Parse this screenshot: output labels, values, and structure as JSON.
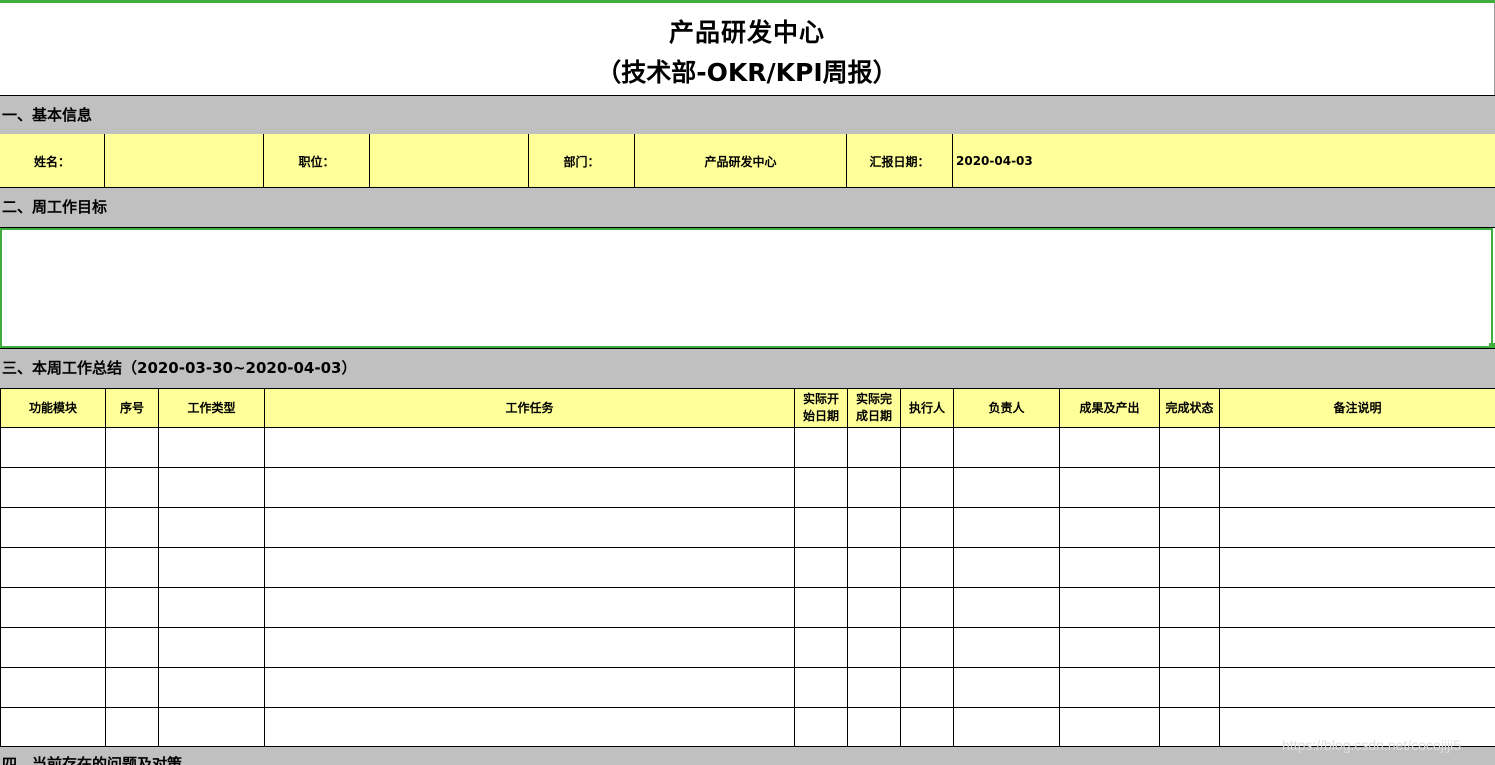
{
  "title": {
    "line1": "产品研发中心",
    "line2": "（技术部-OKR/KPI周报）"
  },
  "sections": {
    "basic_info": "一、基本信息",
    "weekly_goal": "二、周工作目标",
    "weekly_summary": "三、本周工作总结（2020-03-30~2020-04-03）",
    "issues": "四、当前存在的问题及对策"
  },
  "basic_info": {
    "name_label": "姓名：",
    "name_value": "",
    "position_label": "职位：",
    "position_value": "",
    "department_label": "部门：",
    "department_value": "产品研发中心",
    "report_date_label": "汇报日期：",
    "report_date_value": "2020-04-03"
  },
  "work_table": {
    "headers": [
      "功能模块",
      "序号",
      "工作类型",
      "工作任务",
      "实际开始日期",
      "实际完成日期",
      "执行人",
      "负责人",
      "成果及产出",
      "完成状态",
      "备注说明"
    ],
    "rows": [
      [
        "",
        "",
        "",
        "",
        "",
        "",
        "",
        "",
        "",
        "",
        ""
      ],
      [
        "",
        "",
        "",
        "",
        "",
        "",
        "",
        "",
        "",
        "",
        ""
      ],
      [
        "",
        "",
        "",
        "",
        "",
        "",
        "",
        "",
        "",
        "",
        ""
      ],
      [
        "",
        "",
        "",
        "",
        "",
        "",
        "",
        "",
        "",
        "",
        ""
      ],
      [
        "",
        "",
        "",
        "",
        "",
        "",
        "",
        "",
        "",
        "",
        ""
      ],
      [
        "",
        "",
        "",
        "",
        "",
        "",
        "",
        "",
        "",
        "",
        ""
      ],
      [
        "",
        "",
        "",
        "",
        "",
        "",
        "",
        "",
        "",
        "",
        ""
      ],
      [
        "",
        "",
        "",
        "",
        "",
        "",
        "",
        "",
        "",
        "",
        ""
      ]
    ]
  },
  "watermark": "https://blog.csdn.net/cocojiji5",
  "colors": {
    "section_bg": "#c0c0c0",
    "header_bg": "#ffff99",
    "selection_border": "#3fae3f"
  }
}
